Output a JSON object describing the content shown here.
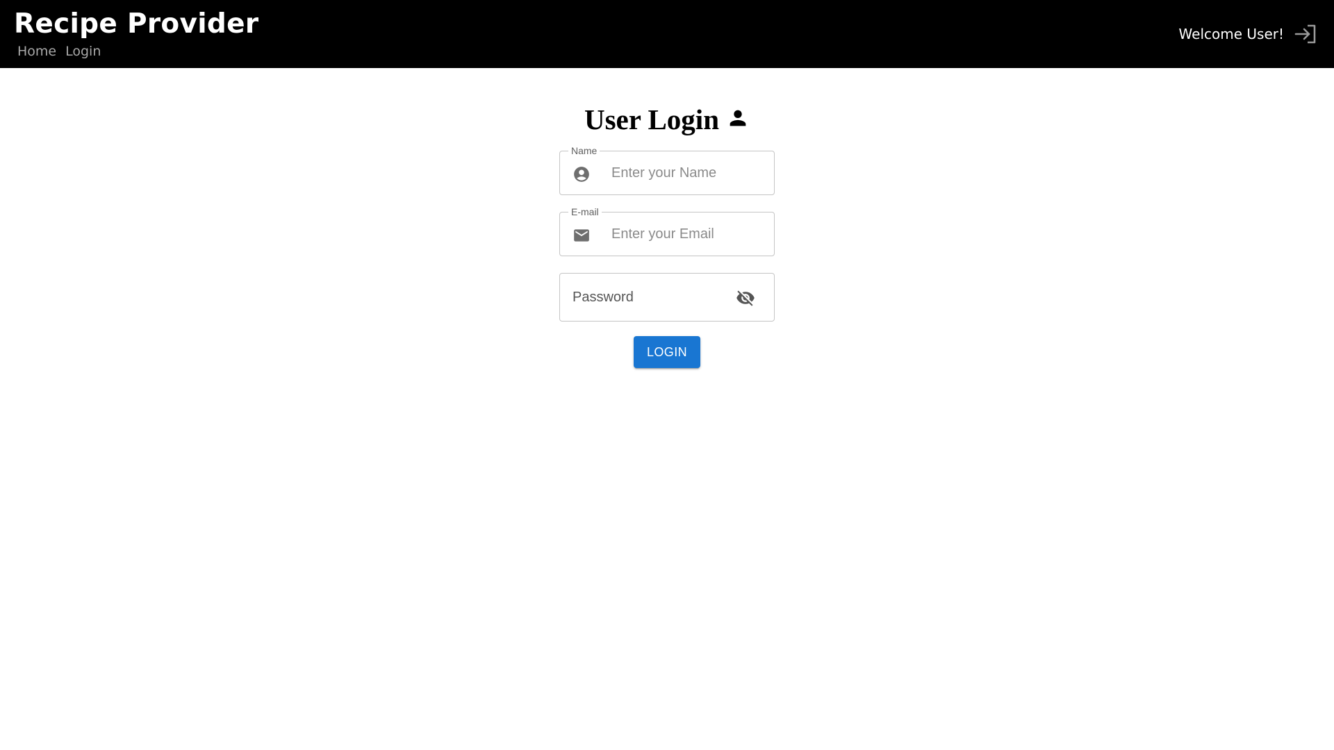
{
  "header": {
    "brand": "Recipe Provider",
    "nav": [
      {
        "label": "Home"
      },
      {
        "label": "Login"
      }
    ],
    "welcome": "Welcome User!",
    "signin_icon": "login-arrow-icon",
    "background": "#000000",
    "nav_color": "#a8a8a8"
  },
  "main": {
    "title": "User Login",
    "title_icon": "person-icon",
    "fields": {
      "name": {
        "label": "Name",
        "placeholder": "Enter your Name",
        "value": "",
        "icon": "account-circle-icon"
      },
      "email": {
        "label": "E-mail",
        "placeholder": "Enter your Email",
        "value": "",
        "icon": "mail-icon"
      },
      "password": {
        "placeholder": "Password",
        "value": "",
        "icon": "visibility-off-icon"
      }
    },
    "submit_label": "LOGIN",
    "accent_color": "#1976d2"
  }
}
